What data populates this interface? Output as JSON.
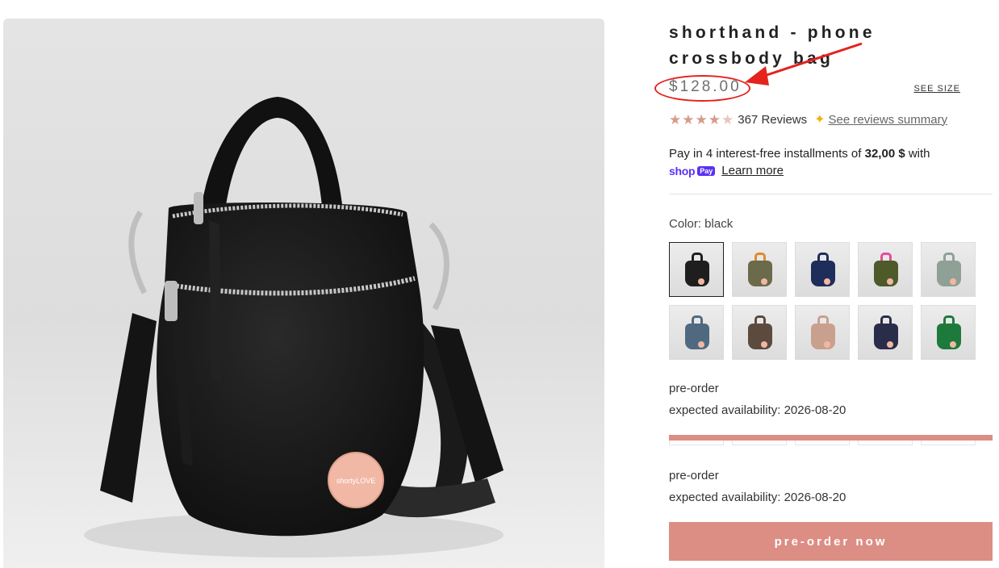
{
  "product": {
    "title": "shorthand - phone crossbody bag",
    "price": "$128.00",
    "see_size": "SEE SIZE",
    "rating": 4.5,
    "review_count": "367 Reviews",
    "reviews_summary_link": "See reviews summary"
  },
  "payment": {
    "installments_prefix": "Pay in 4 interest-free installments of",
    "installment_amount": "32,00 $",
    "installments_suffix": "with",
    "shop_word": "shop",
    "pay_word": "Pay",
    "learn_more": "Learn more"
  },
  "color": {
    "label": "Color: black",
    "swatches": [
      {
        "name": "black",
        "body": "#1e1e1e",
        "handle": "#1e1e1e",
        "selected": true
      },
      {
        "name": "camo",
        "body": "#6b6a4a",
        "handle": "#e08a2a",
        "selected": false
      },
      {
        "name": "navy",
        "body": "#1f2d5a",
        "handle": "#1f2d5a",
        "selected": false
      },
      {
        "name": "olive-pink",
        "body": "#4d5a2a",
        "handle": "#e24d9a",
        "selected": false
      },
      {
        "name": "sage",
        "body": "#8fa096",
        "handle": "#8fa096",
        "selected": false
      },
      {
        "name": "slate-blue",
        "body": "#4f6a80",
        "handle": "#4f6a80",
        "selected": false
      },
      {
        "name": "brown",
        "body": "#5d4a3e",
        "handle": "#5d4a3e",
        "selected": false
      },
      {
        "name": "blush",
        "body": "#c9a08e",
        "handle": "#c9a08e",
        "selected": false
      },
      {
        "name": "navy-purple",
        "body": "#2a2d4a",
        "handle": "#2a2d4a",
        "selected": false
      },
      {
        "name": "green",
        "body": "#1e7a3a",
        "handle": "#1e7a3a",
        "selected": false
      }
    ]
  },
  "availability": {
    "preorder_label_1": "pre-order",
    "expected_1": "expected availability: 2026-08-20",
    "preorder_label_2": "pre-order",
    "expected_2": "expected availability: 2026-08-20"
  },
  "cta": {
    "label": "pre-order now"
  },
  "image": {
    "badge_text": "shortyLOVE"
  },
  "colors": {
    "accent": "#dc8e84",
    "annotation": "#e3231c",
    "shop_pay": "#5a31f4"
  }
}
